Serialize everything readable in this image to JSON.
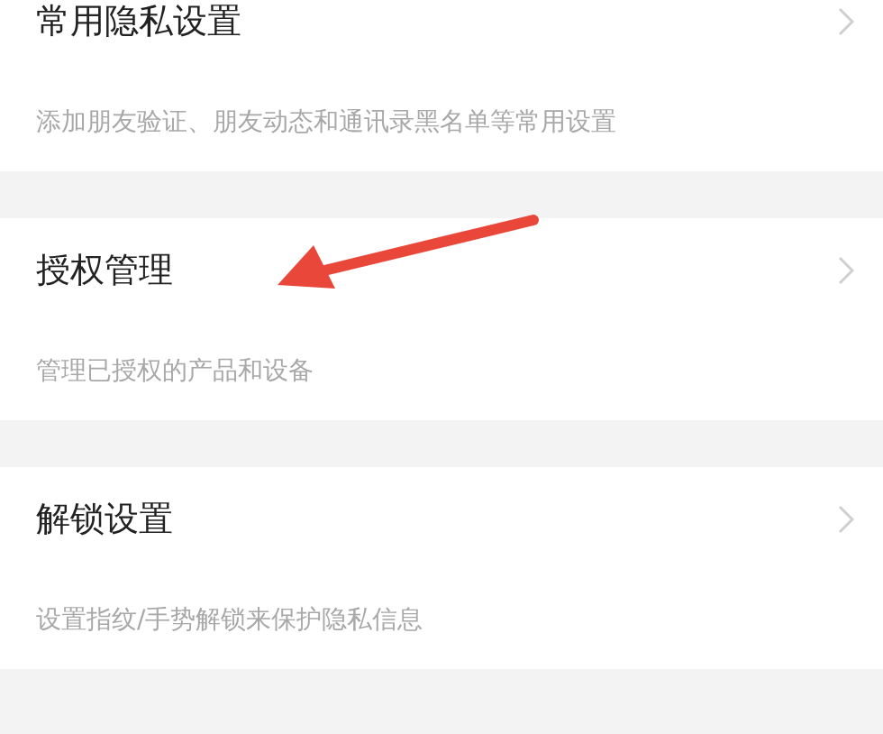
{
  "sections": [
    {
      "title": "常用隐私设置",
      "description": "添加朋友验证、朋友动态和通讯录黑名单等常用设置"
    },
    {
      "title": "授权管理",
      "description": "管理已授权的产品和设备"
    },
    {
      "title": "解锁设置",
      "description": "设置指纹/手势解锁来保护隐私信息"
    }
  ]
}
